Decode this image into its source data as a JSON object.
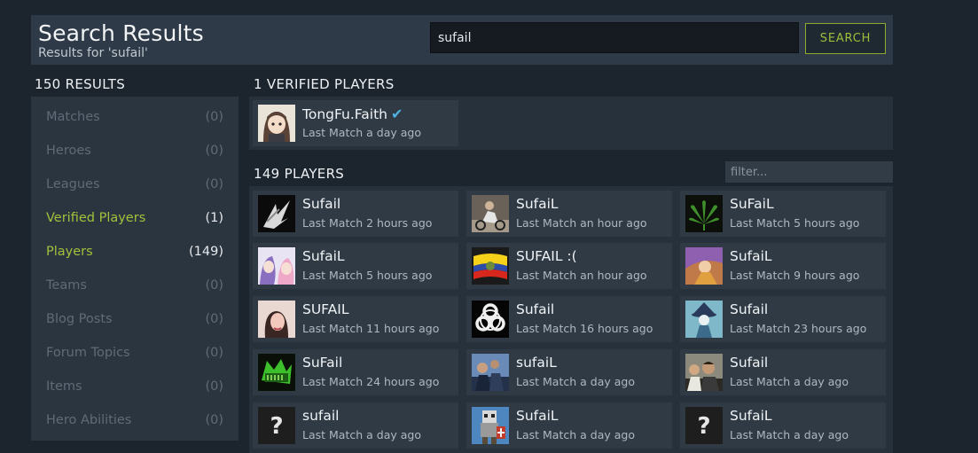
{
  "header": {
    "title": "Search Results",
    "subtitle": "Results for 'sufail'",
    "search_value": "sufail",
    "search_button": "SEARCH"
  },
  "sidebar": {
    "heading": "150 RESULTS",
    "items": [
      {
        "label": "Matches",
        "count": "(0)"
      },
      {
        "label": "Heroes",
        "count": "(0)"
      },
      {
        "label": "Leagues",
        "count": "(0)"
      },
      {
        "label": "Verified Players",
        "count": "(1)"
      },
      {
        "label": "Players",
        "count": "(149)"
      },
      {
        "label": "Teams",
        "count": "(0)"
      },
      {
        "label": "Blog Posts",
        "count": "(0)"
      },
      {
        "label": "Forum Topics",
        "count": "(0)"
      },
      {
        "label": "Items",
        "count": "(0)"
      },
      {
        "label": "Hero Abilities",
        "count": "(0)"
      }
    ]
  },
  "verified": {
    "heading": "1 VERIFIED PLAYERS",
    "players": [
      {
        "name": "TongFu.Faith",
        "last_match": "Last Match a day ago",
        "avatar": "avatar-girl-cartoon"
      }
    ]
  },
  "players": {
    "heading": "149 PLAYERS",
    "filter_placeholder": "filter...",
    "list": [
      {
        "name": "Sufail",
        "last_match": "Last Match 2 hours ago",
        "avatar": "avatar-dark-wings"
      },
      {
        "name": "SufaiL",
        "last_match": "Last Match an hour ago",
        "avatar": "avatar-rider"
      },
      {
        "name": "SuFaiL",
        "last_match": "Last Match 5 hours ago",
        "avatar": "avatar-leaf"
      },
      {
        "name": "SufaiL",
        "last_match": "Last Match 5 hours ago",
        "avatar": "avatar-anime"
      },
      {
        "name": "SUFAIL :(",
        "last_match": "Last Match an hour ago",
        "avatar": "avatar-flag"
      },
      {
        "name": "SufaiL",
        "last_match": "Last Match 9 hours ago",
        "avatar": "avatar-fantasy"
      },
      {
        "name": "SUFAIL",
        "last_match": "Last Match 11 hours ago",
        "avatar": "avatar-portrait"
      },
      {
        "name": "Sufail",
        "last_match": "Last Match 16 hours ago",
        "avatar": "avatar-biohazard"
      },
      {
        "name": "Sufail",
        "last_match": "Last Match 23 hours ago",
        "avatar": "avatar-wizard"
      },
      {
        "name": "SuFail",
        "last_match": "Last Match 24 hours ago",
        "avatar": "avatar-green-logo"
      },
      {
        "name": "sufaiL",
        "last_match": "Last Match a day ago",
        "avatar": "avatar-crowd"
      },
      {
        "name": "Sufail",
        "last_match": "Last Match a day ago",
        "avatar": "avatar-group-photo"
      },
      {
        "name": "sufail",
        "last_match": "Last Match a day ago",
        "avatar": "avatar-unknown"
      },
      {
        "name": "SufaiL",
        "last_match": "Last Match a day ago",
        "avatar": "avatar-pixel-knight"
      },
      {
        "name": "SufaiL",
        "last_match": "Last Match a day ago",
        "avatar": "avatar-unknown"
      }
    ]
  },
  "colors": {
    "background": "#1c242d",
    "panel": "#27313b",
    "card": "#2f3a45",
    "accent_green": "#a3c13a",
    "verified_check": "#4fb3e3"
  }
}
